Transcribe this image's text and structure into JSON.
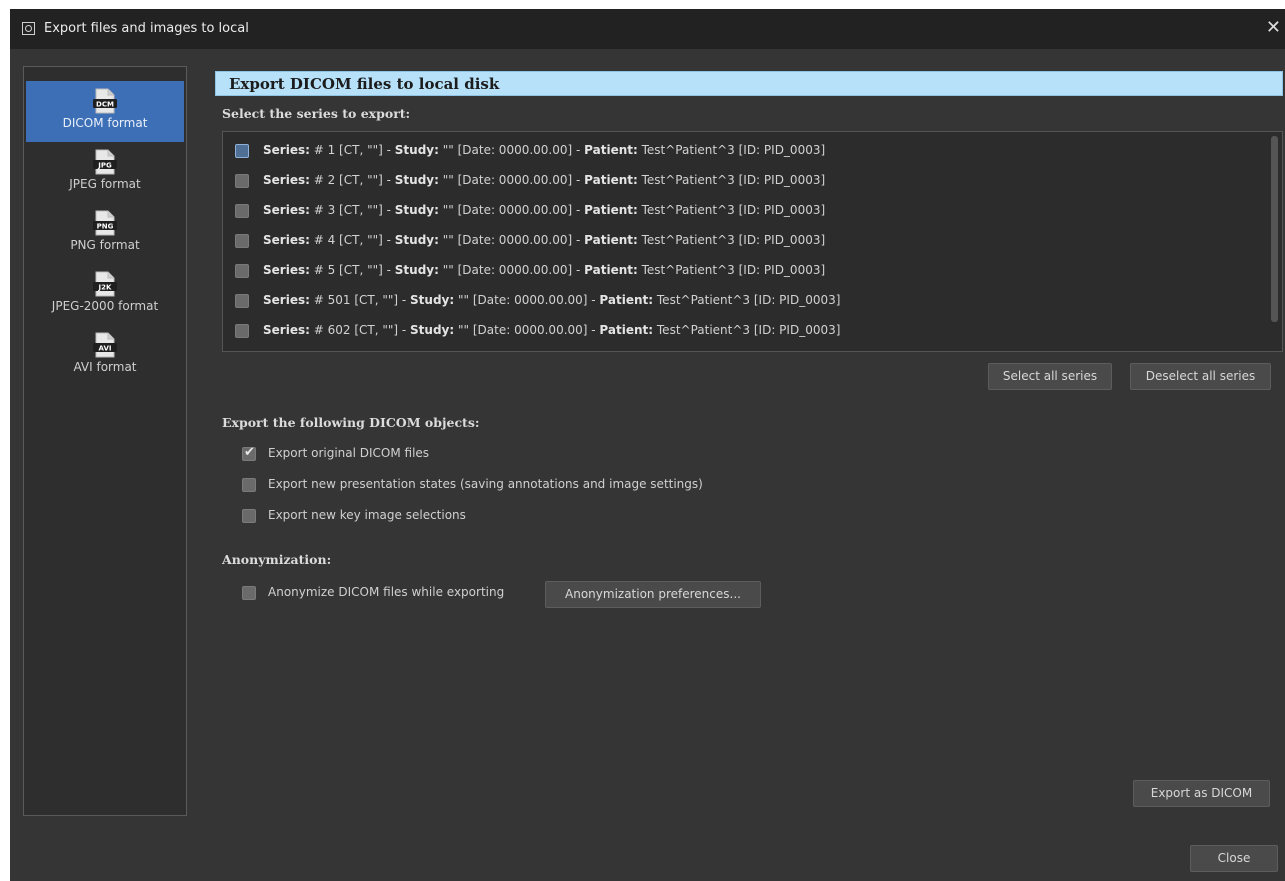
{
  "window": {
    "title": "Export files and images to local"
  },
  "sidebar": {
    "items": [
      {
        "icon": "DCM",
        "label": "DICOM format",
        "active": true
      },
      {
        "icon": "JPG",
        "label": "JPEG format",
        "active": false
      },
      {
        "icon": "PNG",
        "label": "PNG format",
        "active": false
      },
      {
        "icon": "J2K",
        "label": "JPEG-2000 format",
        "active": false
      },
      {
        "icon": "AVI",
        "label": "AVI format",
        "active": false
      }
    ]
  },
  "main": {
    "header": "Export DICOM files to local disk",
    "series_label": "Select the series to export:",
    "series": [
      {
        "series_key": "Series:",
        "series_val": "# 1 [CT, \"\"] - ",
        "study_key": "Study:",
        "study_val": "\"\" [Date: 0000.00.00] - ",
        "patient_key": "Patient:",
        "patient_val": "Test^Patient^3 [ID: PID_0003]",
        "checked": false
      },
      {
        "series_key": "Series:",
        "series_val": "# 2 [CT, \"\"] - ",
        "study_key": "Study:",
        "study_val": "\"\" [Date: 0000.00.00] - ",
        "patient_key": "Patient:",
        "patient_val": "Test^Patient^3 [ID: PID_0003]",
        "checked": false
      },
      {
        "series_key": "Series:",
        "series_val": "# 3 [CT, \"\"] - ",
        "study_key": "Study:",
        "study_val": "\"\" [Date: 0000.00.00] - ",
        "patient_key": "Patient:",
        "patient_val": "Test^Patient^3 [ID: PID_0003]",
        "checked": false
      },
      {
        "series_key": "Series:",
        "series_val": "# 4 [CT, \"\"] - ",
        "study_key": "Study:",
        "study_val": "\"\" [Date: 0000.00.00] - ",
        "patient_key": "Patient:",
        "patient_val": "Test^Patient^3 [ID: PID_0003]",
        "checked": false
      },
      {
        "series_key": "Series:",
        "series_val": "# 5 [CT, \"\"] - ",
        "study_key": "Study:",
        "study_val": "\"\" [Date: 0000.00.00] - ",
        "patient_key": "Patient:",
        "patient_val": "Test^Patient^3 [ID: PID_0003]",
        "checked": false
      },
      {
        "series_key": "Series:",
        "series_val": "# 501 [CT, \"\"] - ",
        "study_key": "Study:",
        "study_val": "\"\" [Date: 0000.00.00] - ",
        "patient_key": "Patient:",
        "patient_val": "Test^Patient^3 [ID: PID_0003]",
        "checked": false
      },
      {
        "series_key": "Series:",
        "series_val": "# 602 [CT, \"\"] - ",
        "study_key": "Study:",
        "study_val": "\"\" [Date: 0000.00.00] - ",
        "patient_key": "Patient:",
        "patient_val": "Test^Patient^3 [ID: PID_0003]",
        "checked": false
      }
    ],
    "select_all_label": "Select all series",
    "deselect_all_label": "Deselect all series",
    "objects_label": "Export the following DICOM objects:",
    "objects": [
      {
        "label": "Export original DICOM files",
        "checked": true
      },
      {
        "label": "Export new presentation states (saving annotations and image settings)",
        "checked": false
      },
      {
        "label": "Export new key image selections",
        "checked": false
      }
    ],
    "anonymization_label": "Anonymization:",
    "anonymize_option": {
      "label": "Anonymize DICOM files while exporting",
      "checked": false
    },
    "anonymization_prefs_label": "Anonymization preferences...",
    "export_button_label": "Export as DICOM"
  },
  "footer": {
    "close_label": "Close"
  },
  "colors": {
    "active_item": "#3d6fb6",
    "header_bg": "#b6e1f9",
    "window_bg": "#353535"
  }
}
